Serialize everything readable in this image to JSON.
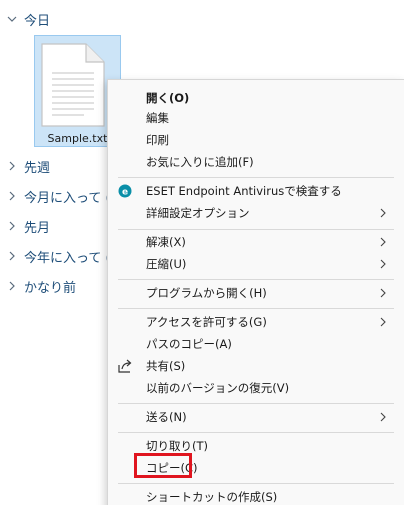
{
  "groups": [
    {
      "label": "今日",
      "expanded": true
    },
    {
      "label": "先週",
      "expanded": false
    },
    {
      "label": "今月に入って (",
      "expanded": false
    },
    {
      "label": "先月",
      "expanded": false
    },
    {
      "label": "今年に入って (",
      "expanded": false
    },
    {
      "label": "かなり前",
      "expanded": false
    }
  ],
  "file": {
    "name": "Sample.txt",
    "icon": "text-document-icon",
    "selected": true
  },
  "menu": {
    "items": [
      {
        "label": "開く(O)",
        "bold": true
      },
      {
        "label": "編集"
      },
      {
        "label": "印刷"
      },
      {
        "label": "お気に入りに追加(F)"
      },
      {
        "label": "ESET Endpoint Antivirusで検査する",
        "icon": "eset-icon"
      },
      {
        "label": "詳細設定オプション",
        "submenu": true
      },
      {
        "label": "解凍(X)",
        "submenu": true
      },
      {
        "label": "圧縮(U)",
        "submenu": true
      },
      {
        "label": "プログラムから開く(H)",
        "submenu": true
      },
      {
        "label": "アクセスを許可する(G)",
        "submenu": true
      },
      {
        "label": "パスのコピー(A)"
      },
      {
        "label": "共有(S)",
        "icon": "share-icon"
      },
      {
        "label": "以前のバージョンの復元(V)"
      },
      {
        "label": "送る(N)",
        "submenu": true
      },
      {
        "label": "切り取り(T)"
      },
      {
        "label": "コピー(C)",
        "highlighted": true
      },
      {
        "label": "ショートカットの作成(S)"
      }
    ]
  },
  "colors": {
    "group_text": "#1f4e79",
    "selection_bg": "#cce4f7",
    "highlight_border": "#e0151f",
    "eset_accent": "#0a8fa8"
  }
}
